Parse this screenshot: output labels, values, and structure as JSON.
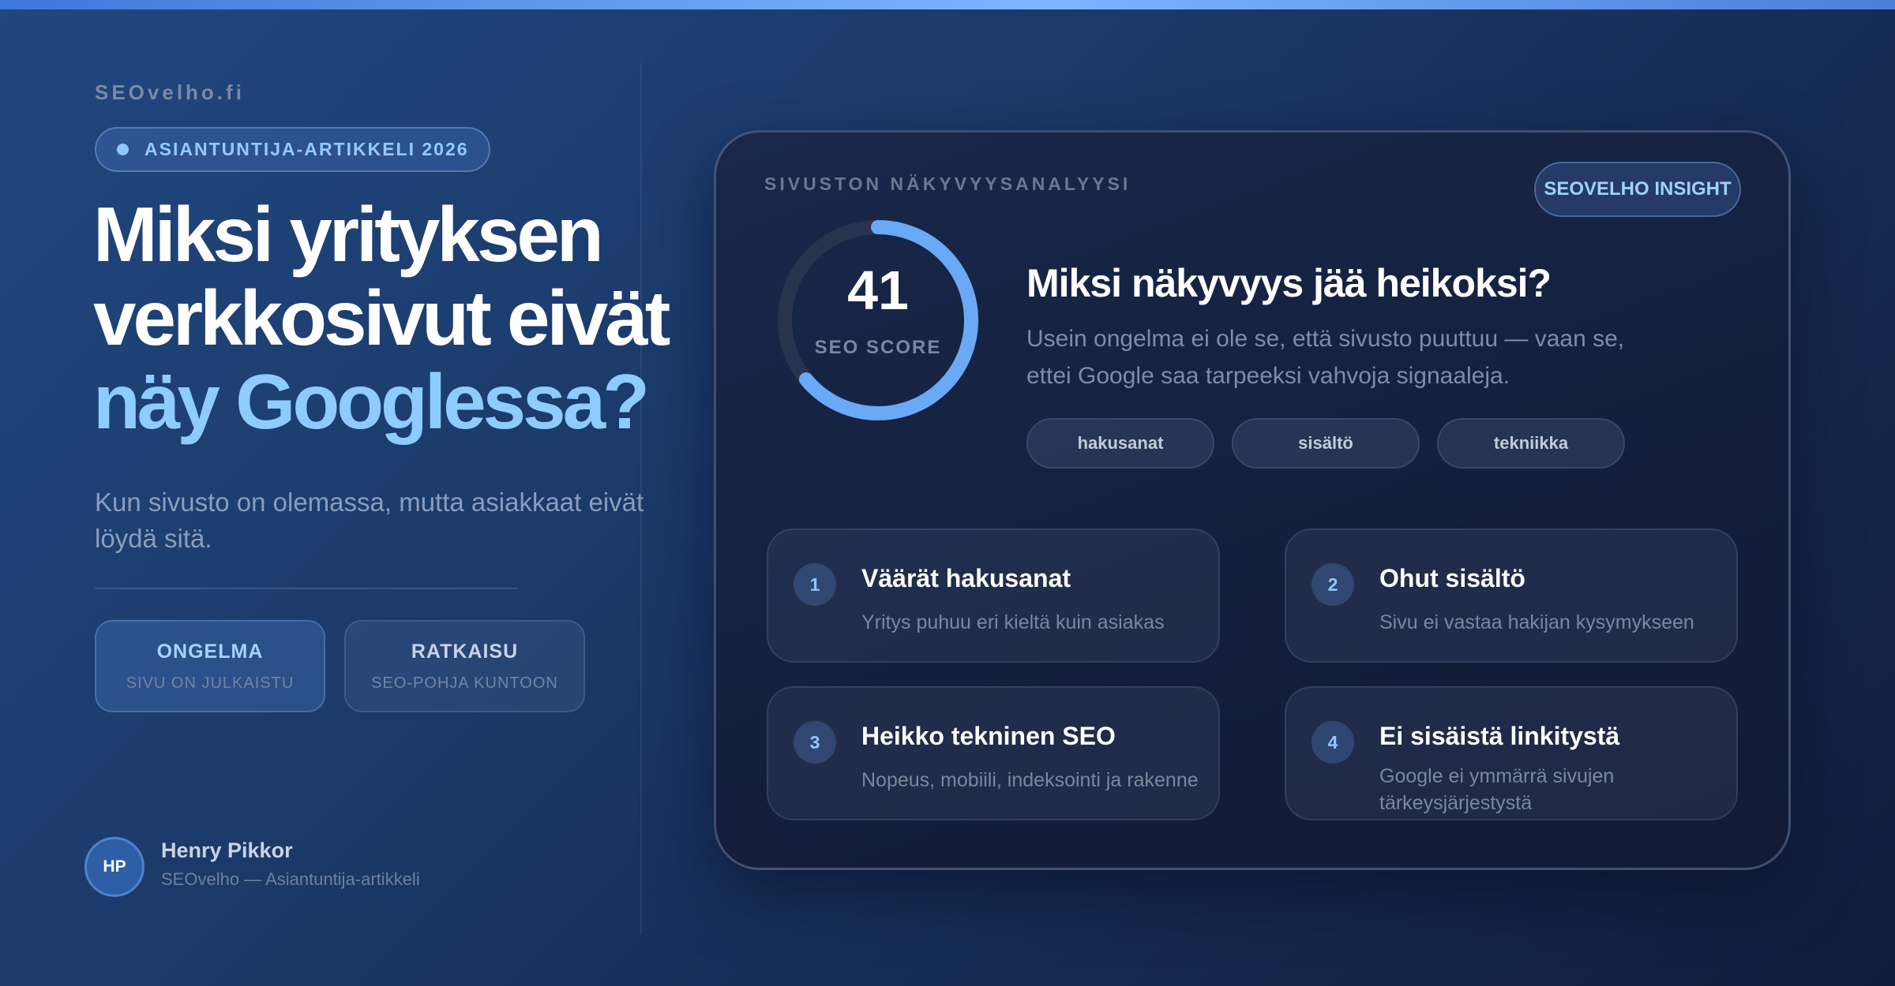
{
  "brand": "SEOvelho.fi",
  "badge": "ASIANTUNTIJA-ARTIKKELI 2026",
  "headline": {
    "line1": "Miksi yrityksen",
    "line2": "verkkosivut eivät",
    "line3": "näy Googlessa?"
  },
  "subtitle": "Kun sivusto on olemassa, mutta asiakkaat eivät löydä sitä.",
  "tags": {
    "problem": {
      "title": "ONGELMA",
      "sub": "SIVU ON JULKAISTU"
    },
    "solution": {
      "title": "RATKAISU",
      "sub": "SEO-POHJA KUNTOON"
    }
  },
  "author": {
    "initials": "HP",
    "name": "Henry Pikkor",
    "role": "SEOvelho — Asiantuntija-artikkeli"
  },
  "card": {
    "label": "SIVUSTON NÄKYVYYSANALYYSI",
    "insight": "SEOVELHO INSIGHT",
    "score": {
      "value": "41",
      "label": "SEO SCORE",
      "progress": 0.64
    },
    "heading": "Miksi näkyvyys jää heikoksi?",
    "text": "Usein ongelma ei ole se, että sivusto puuttuu — vaan se, ettei Google saa tarpeeksi vahvoja signaaleja.",
    "chips": [
      "hakusanat",
      "sisältö",
      "tekniikka"
    ],
    "issues": [
      {
        "num": "1",
        "title": "Väärät hakusanat",
        "desc": "Yritys puhuu eri kieltä kuin asiakas"
      },
      {
        "num": "2",
        "title": "Ohut sisältö",
        "desc": "Sivu ei vastaa hakijan kysymykseen"
      },
      {
        "num": "3",
        "title": "Heikko tekninen SEO",
        "desc": "Nopeus, mobiili, indeksointi ja rakenne"
      },
      {
        "num": "4",
        "title": "Ei sisäistä linkitystä",
        "desc": "Google ei ymmärrä sivujen tärkeysjärjestystä"
      }
    ]
  },
  "colors": {
    "accent": "#8ecbff",
    "gauge_arc": "#6aa9f5",
    "gauge_track": "#28344e",
    "background": "#1b3a6a"
  }
}
